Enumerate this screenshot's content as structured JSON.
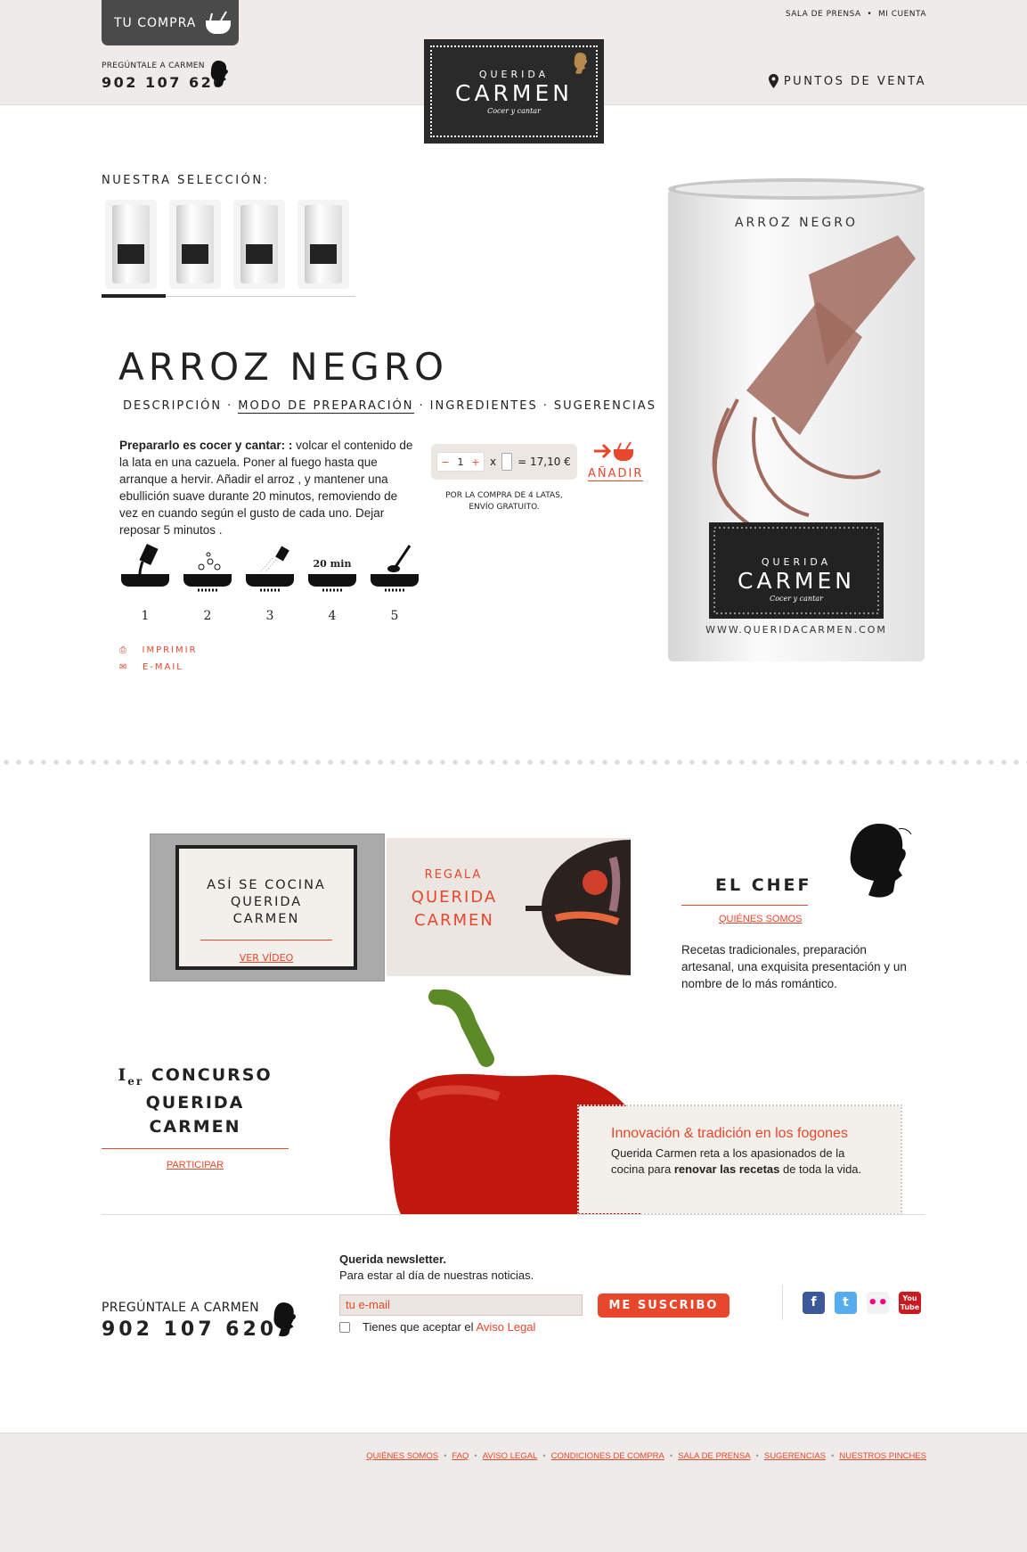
{
  "header": {
    "cart_label": "TU COMPRA",
    "ask_label": "PREGÚNTALE A CARMEN",
    "phone": "902 107 620",
    "logo_top": "QUERIDA",
    "logo_main": "CARMEN",
    "logo_sub": "Cocer y cantar",
    "links": [
      "SALA DE PRENSA",
      "MI CUENTA"
    ],
    "puntos_label": "PUNTOS DE VENTA"
  },
  "selection": {
    "title": "NUESTRA SELECCIÓN:"
  },
  "product": {
    "title": "ARROZ NEGRO",
    "tabs": [
      "DESCRIPCIÓN",
      "MODO DE PREPARACIÓN",
      "INGREDIENTES",
      "SUGERENCIAS"
    ],
    "active_tab": "MODO DE PREPARACIÓN",
    "desc_bold": "Prepararlo es cocer y cantar: :",
    "desc_text": " volcar el contenido de la lata en una cazuela. Poner al fuego hasta que arranque a hervir. Añadir el arroz , y mantener una ebullición suave durante 20 minutos, removiendo de vez en cuando según el gusto de cada uno. Dejar reposar 5 minutos .",
    "qty": "1",
    "minus": "−",
    "plus": "+",
    "times": "x",
    "price": "= 17,10 €",
    "add_label": "AÑADIR",
    "promo": "POR LA COMPRA DE 4 LATAS, ENVÍO GRATUITO.",
    "step_label_4": "20 min",
    "steps": [
      "1",
      "2",
      "3",
      "4",
      "5"
    ],
    "print_label": "IMPRIMIR",
    "email_label": "E-MAIL",
    "can_title": "ARROZ NEGRO",
    "can_url": "WWW.QUERIDACARMEN.COM"
  },
  "blocks": {
    "video_title": "ASÍ SE COCINA QUERIDA CARMEN",
    "video_link": "VER VÍDEO",
    "regala_small": "REGALA",
    "regala_big": "QUERIDA CARMEN",
    "chef_title": "EL CHEF",
    "chef_link": "QUIÉNES SOMOS",
    "chef_text": "Recetas tradicionales, preparación artesanal, una exquisita presentación y un nombre de lo más romántico.",
    "concurso_num": "I",
    "concurso_sup": "er",
    "concurso_word": "CONCURSO",
    "concurso_name": "QUERIDA CARMEN",
    "concurso_link": "PARTICIPAR",
    "innov_title": "Innovación & tradición en los fogones",
    "innov_text_a": "Querida Carmen reta a los apasionados de la cocina para ",
    "innov_bold": "renovar las recetas",
    "innov_text_b": " de toda la vida."
  },
  "footer": {
    "nl_title": "Querida newsletter.",
    "nl_sub": "Para estar al día de nuestras noticias.",
    "email_placeholder": "tu e-mail",
    "subscribe": "ME SUSCRIBO",
    "accept_text": "Tienes que aceptar el ",
    "accept_link": "Aviso Legal",
    "ask_label": "PREGÚNTALE A CARMEN",
    "phone": "902 107 620",
    "social": [
      "facebook",
      "twitter",
      "flickr",
      "youtube"
    ],
    "links": [
      "QUIÉNES SOMOS",
      "FAQ",
      "AVISO LEGAL",
      "CONDICIONES DE COMPRA",
      "SALA DE PRENSA",
      "SUGERENCIAS",
      "NUESTROS PINCHES"
    ]
  },
  "colors": {
    "accent": "#e8472b",
    "dark": "#2a2a2a",
    "beige": "#efebe8"
  }
}
